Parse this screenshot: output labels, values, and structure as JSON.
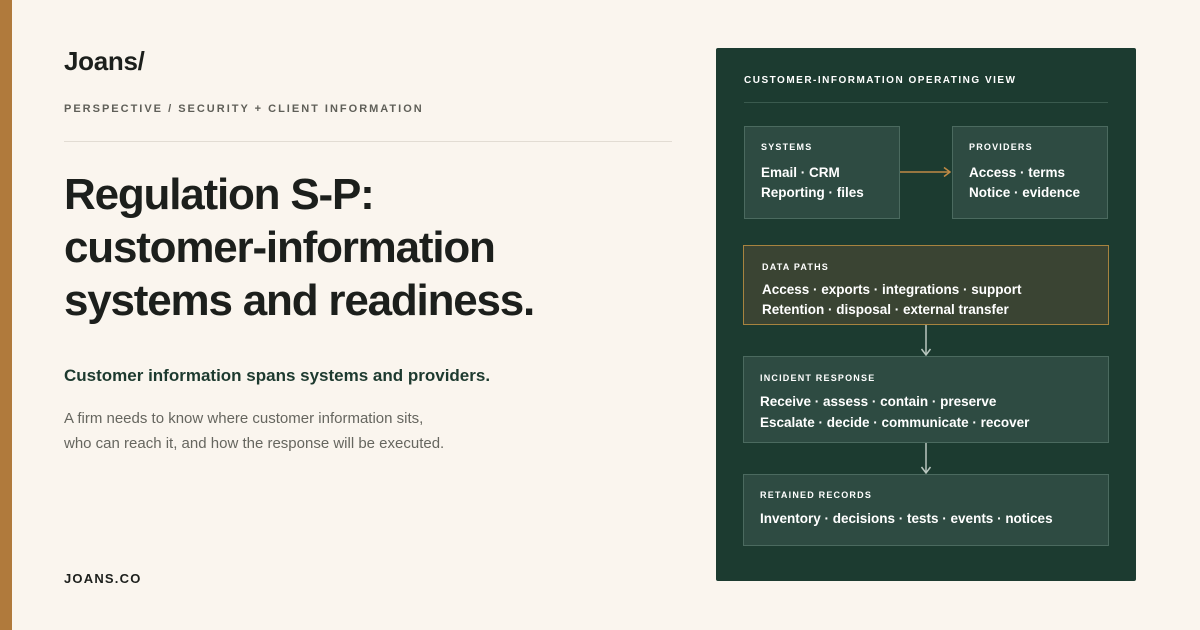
{
  "brand": "Joans/",
  "kicker": "PERSPECTIVE / SECURITY + CLIENT INFORMATION",
  "headline": {
    "line1": "Regulation S-P:",
    "line2": "customer-information",
    "line3": "systems and readiness."
  },
  "subhead": "Customer information spans systems and providers.",
  "body": {
    "line1": "A firm needs to know where customer information sits,",
    "line2": "who can reach it, and how the response will be executed."
  },
  "footer": "JOANS.CO",
  "colors": {
    "background": "#faf5ee",
    "accent": "#b07a3c",
    "panel": "#1c3b30",
    "box": "#2e4b42",
    "highlight_border": "#a7833f"
  },
  "diagram": {
    "title": "CUSTOMER-INFORMATION OPERATING VIEW",
    "systems": {
      "label": "SYSTEMS",
      "line1": "Email · CRM",
      "line2": "Reporting · files"
    },
    "providers": {
      "label": "PROVIDERS",
      "line1": "Access · terms",
      "line2": "Notice · evidence"
    },
    "data_paths": {
      "label": "DATA PATHS",
      "line1": "Access · exports · integrations · support",
      "line2": "Retention · disposal · external transfer"
    },
    "incident_response": {
      "label": "INCIDENT RESPONSE",
      "line1": "Receive · assess · contain · preserve",
      "line2": "Escalate · decide · communicate · recover"
    },
    "retained_records": {
      "label": "RETAINED RECORDS",
      "line1": "Inventory · decisions · tests · events · notices"
    }
  }
}
